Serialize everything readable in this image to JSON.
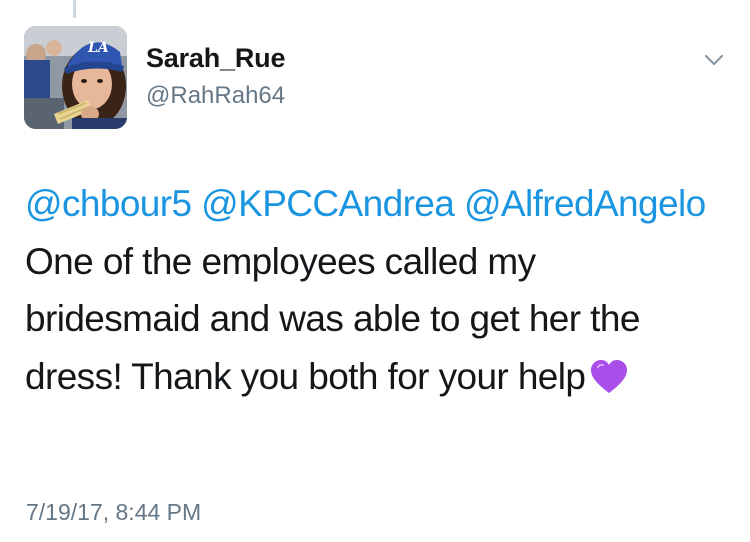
{
  "author": {
    "display_name": "Sarah_Rue",
    "handle": "@RahRah64",
    "avatar_icon": "profile-photo",
    "avatar_cap_text": "LA"
  },
  "menu": {
    "icon": "chevron-down-icon"
  },
  "tweet": {
    "mentions": [
      "@chbour5",
      "@KPCCAndrea",
      "@AlfredAngelo"
    ],
    "body": "One of the employees called my bridesmaid and was able to get her the dress! Thank you both for your help",
    "emoji": "purple-heart",
    "timestamp": "7/19/17, 8:44 PM"
  },
  "colors": {
    "link": "#1b95e0",
    "text": "#14171a",
    "secondary": "#657786",
    "emoji": "#a94ee8"
  }
}
